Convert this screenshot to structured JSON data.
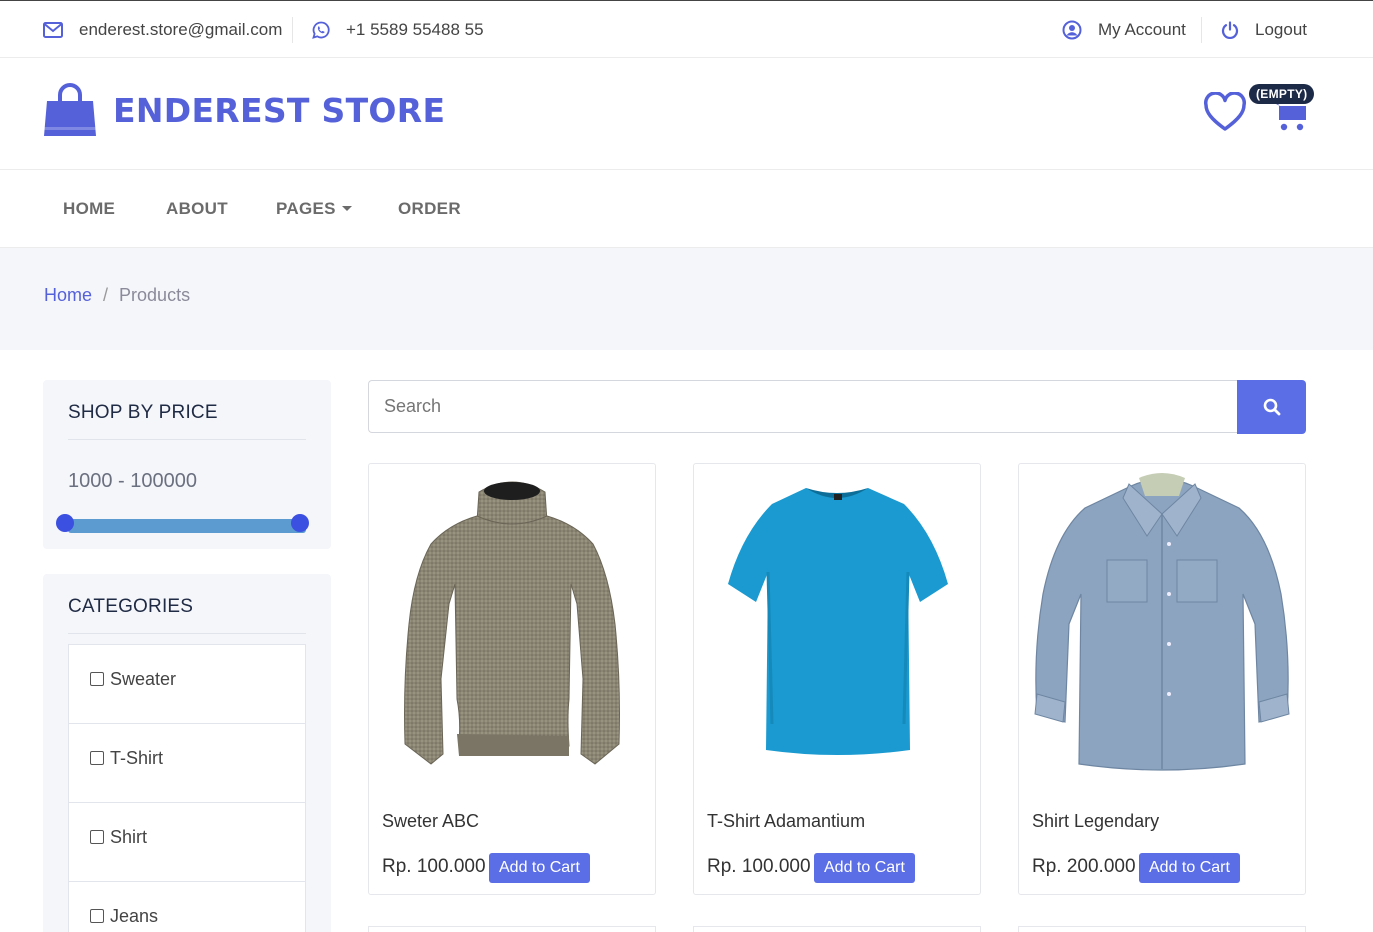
{
  "topbar": {
    "email": "enderest.store@gmail.com",
    "phone": "+1 5589 55488 55",
    "account": "My Account",
    "logout": "Logout"
  },
  "brand": {
    "name": "ENDEREST STORE",
    "color": "#5561d9"
  },
  "cart": {
    "badge": "(EMPTY)"
  },
  "nav": {
    "home": "HOME",
    "about": "ABOUT",
    "pages": "PAGES",
    "order": "ORDER"
  },
  "breadcrumb": {
    "home": "Home",
    "separator": "/",
    "current": "Products"
  },
  "price_filter": {
    "title": "SHOP BY PRICE",
    "range": "1000 - 100000",
    "min": 1000,
    "max": 100000
  },
  "categories": {
    "title": "CATEGORIES",
    "items": [
      {
        "label": "Sweater"
      },
      {
        "label": "T-Shirt"
      },
      {
        "label": "Shirt"
      },
      {
        "label": "Jeans"
      }
    ]
  },
  "search": {
    "placeholder": "Search"
  },
  "products": [
    {
      "name": "Sweter ABC",
      "price": "Rp. 100.000",
      "button": "Add to Cart"
    },
    {
      "name": "T-Shirt Adamantium",
      "price": "Rp. 100.000",
      "button": "Add to Cart"
    },
    {
      "name": "Shirt Legendary",
      "price": "Rp. 200.000",
      "button": "Add to Cart"
    }
  ],
  "icons": [
    "envelope-icon",
    "whatsapp-icon",
    "user-circle-icon",
    "power-icon",
    "shopping-bag-icon",
    "heart-icon",
    "cart-icon",
    "search-icon",
    "caret-down-icon"
  ]
}
